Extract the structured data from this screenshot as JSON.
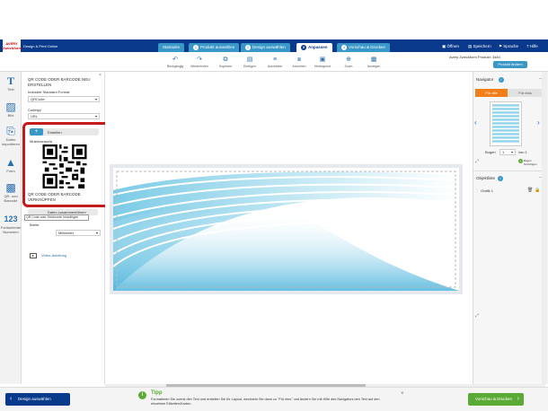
{
  "header": {
    "logo_text": "AVERY Zweckform",
    "app_title": "Design & Print Online",
    "steps": [
      {
        "num": "",
        "label": "Startseite"
      },
      {
        "num": "1",
        "label": "Produkt auswählen"
      },
      {
        "num": "2",
        "label": "Design auswählen"
      },
      {
        "num": "3",
        "label": "Anpassen"
      },
      {
        "num": "4",
        "label": "Vorschau & Drucken"
      }
    ],
    "links": {
      "open": "Öffnen",
      "save": "Speichern",
      "language": "Sprache",
      "help": "Hilfe"
    }
  },
  "toolbar": {
    "tools": [
      "Rückgängig",
      "Wiederholen",
      "Kopieren",
      "Einfügen",
      "Ausrichten",
      "Anordnen",
      "Hintergrund",
      "Zoom",
      "Anzeigen"
    ],
    "product_info": "Avery Zweckform Produkt: 3484",
    "product_button": "Produkt ändern"
  },
  "left_tools": [
    {
      "label": "Text",
      "icon": "text-icon"
    },
    {
      "label": "Bild",
      "icon": "image-icon"
    },
    {
      "label": "Daten importieren",
      "icon": "import-icon"
    },
    {
      "label": "Form",
      "icon": "shape-icon"
    },
    {
      "label": "QR- und Barcode",
      "icon": "qrcode-icon"
    },
    {
      "label": "Fortlaufende Nummern",
      "icon": "numbering-icon"
    }
  ],
  "panel": {
    "title": "QR CODE ODER BARCODE NEU ERSTELLEN",
    "standard_label": "Industrie Standard Format",
    "standard_value": "QRCode",
    "type_label": "Codetyp",
    "type_value": "URL",
    "create_button": "Erstellen",
    "preview_label": "Musteransicht",
    "link_title": "QR CODE ODER BARCODE VERKNÜPFEN",
    "link_button": "Daten zusammenführen",
    "tooltip": "QR Code oder Strichcode hinzufügen",
    "width_label": "Breite",
    "unit_value": "Millimeter",
    "video_link": "Video-Anleitung"
  },
  "navigator": {
    "title": "Navigator",
    "tab_all": "Für alle",
    "tab_one": "Für eins",
    "sheet_label": "Bogen",
    "sheet_value": "1",
    "of_label": "von 1",
    "add_sheet": "Bogen hinzufügen"
  },
  "objects": {
    "title": "Objektliste",
    "items": [
      "Grafik 1"
    ]
  },
  "footer": {
    "back_button": "Design auswählen",
    "tip_title": "Tipp",
    "tip_text": "Formatieren Sie zuerst den Text und erstellen Sie Ihr Layout, wechseln Sie dann zu \"Für eins\" und ändern Sie mit Hilfe des Navigators den Text auf den einzelnen Etiketten/Karten.",
    "next_button": "Vorschau & Drucken"
  },
  "colors": {
    "brand": "#0a3a8c",
    "accent": "#3a98c9",
    "highlight": "#c41a1a",
    "go": "#5aaa35",
    "orange": "#f07e1a"
  }
}
